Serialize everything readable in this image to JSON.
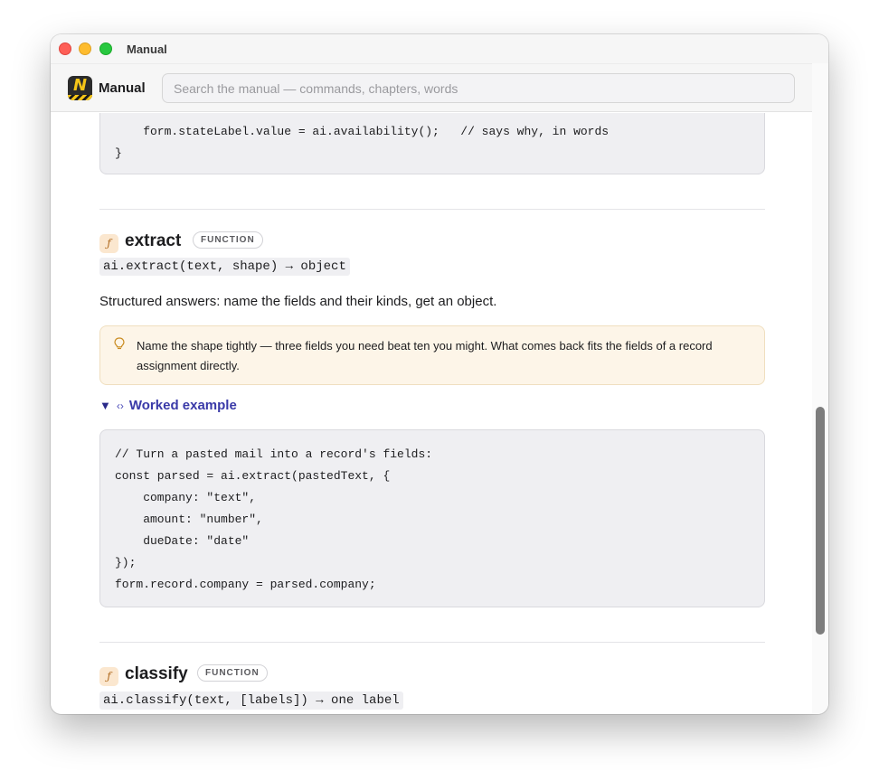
{
  "window": {
    "title": "Manual"
  },
  "header": {
    "app_name": "Manual",
    "logo_letter": "N",
    "search_placeholder": "Search the manual — commands, chapters, words"
  },
  "top_code": {
    "lines": [
      "    form.stateLabel.value = ai.availability();   // says why, in words",
      "}"
    ]
  },
  "entries": [
    {
      "icon": "ƒ",
      "name": "extract",
      "badge": "FUNCTION",
      "signature": "ai.extract(text, shape) → object",
      "description": "Structured answers: name the fields and their kinds, get an object.",
      "tip_icon": "lightbulb-icon",
      "tip": "Name the shape tightly — three fields you need beat ten you might. What comes back fits the fields of a record assignment directly.",
      "example_toggle": {
        "triangle": "▼",
        "code_icon": "‹›",
        "label": "Worked example"
      },
      "example_code": [
        "// Turn a pasted mail into a record's fields:",
        "const parsed = ai.extract(pastedText, {",
        "    company: \"text\",",
        "    amount: \"number\",",
        "    dueDate: \"date\"",
        "});",
        "form.record.company = parsed.company;"
      ]
    },
    {
      "icon": "ƒ",
      "name": "classify",
      "badge": "FUNCTION",
      "signature": "ai.classify(text, [labels]) → one label"
    }
  ],
  "colors": {
    "accent": "#3a3aa8",
    "fn_icon_bg": "#fbe7cf",
    "tip_bg": "#fdf5e8",
    "code_bg": "#efeff2"
  }
}
